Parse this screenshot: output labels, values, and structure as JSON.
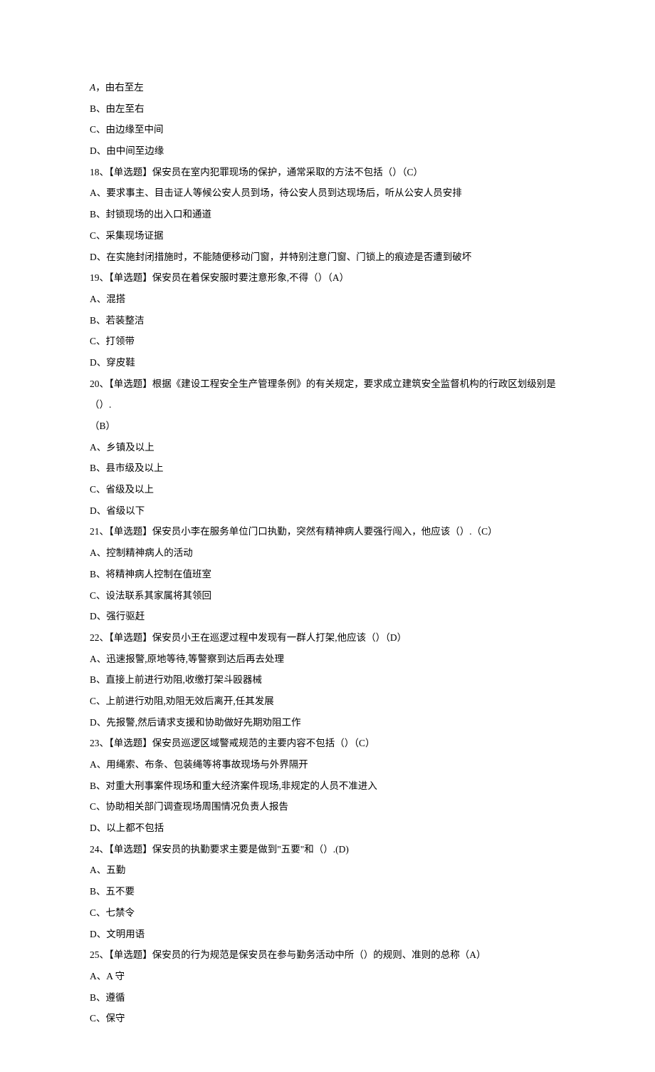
{
  "lines": [
    {
      "text": "A，由右至左",
      "italicFirst": true
    },
    {
      "text": "B、由左至右"
    },
    {
      "text": "C、由边缘至中间"
    },
    {
      "text": "D、由中间至边缘"
    },
    {
      "text": "18、【单选题】保安员在室内犯罪现场的保护，通常采取的方法不包括（）（C）"
    },
    {
      "text": "A、要求事主、目击证人等候公安人员到场，待公安人员到达现场后，听从公安人员安排"
    },
    {
      "text": "B、封锁现场的出入口和通道"
    },
    {
      "text": "C、采集现场证据"
    },
    {
      "text": "D、在实施封闭措施时，不能随便移动门窗，并特别注意门窗、门锁上的痕迹是否遭到破坏"
    },
    {
      "text": "19、【单选题】保安员在着保安服时要注意形象,不得（）（A）"
    },
    {
      "text": "A、混搭"
    },
    {
      "text": "B、若装整洁"
    },
    {
      "text": "C、打领带"
    },
    {
      "text": "D、穿皮鞋"
    },
    {
      "text": "20、【单选题】根据《建设工程安全生产管理条例》的有关规定，要求成立建筑安全监督机构的行政区划级别是（）."
    },
    {
      "text": "（B）"
    },
    {
      "text": "A、乡镇及以上"
    },
    {
      "text": "B、县市级及以上"
    },
    {
      "text": "C、省级及以上"
    },
    {
      "text": "D、省级以下"
    },
    {
      "text": "21、【单选题】保安员小李在服务单位门口执勤，突然有精神病人要强行闯入，他应该（）.（C）"
    },
    {
      "text": "A、控制精神病人的活动"
    },
    {
      "text": "B、将精神病人控制在值班室"
    },
    {
      "text": "C、设法联系其家属将其领回"
    },
    {
      "text": "D、强行驱赶"
    },
    {
      "text": "22、【单选题】保安员小王在巡逻过程中发现有一群人打架,他应该（）（D）"
    },
    {
      "text": "A、迅速报警,原地等待,等警察到达后再去处理"
    },
    {
      "text": "B、直接上前进行劝阻,收缴打架斗殴器械"
    },
    {
      "text": "C、上前进行劝阻,劝阻无效后离开,任其发展"
    },
    {
      "text": "D、先报警,然后请求支援和协助做好先期劝阻工作"
    },
    {
      "text": "23、【单选题】保安员巡逻区域警戒规范的主要内容不包括（）（C）"
    },
    {
      "text": "A、用绳索、布条、包装绳等将事故现场与外界隔开"
    },
    {
      "text": "B、对重大刑事案件现场和重大经济案件现场,非规定的人员不准进入"
    },
    {
      "text": "C、协助相关部门调查现场周围情况负责人报告"
    },
    {
      "text": "D、以上都不包括"
    },
    {
      "text": "24、【单选题】保安员的执勤要求主要是做到\"五要\"和（）.(D)"
    },
    {
      "text": "A、五勤"
    },
    {
      "text": "B、五不要"
    },
    {
      "text": "C、七禁令"
    },
    {
      "text": "D、文明用语"
    },
    {
      "text": "25、【单选题】保安员的行为规范是保安员在参与勤务活动中所（）的规则、准则的总称（A）"
    },
    {
      "text": "A、A 守"
    },
    {
      "text": "B、遵循"
    },
    {
      "text": "C、保守"
    }
  ]
}
